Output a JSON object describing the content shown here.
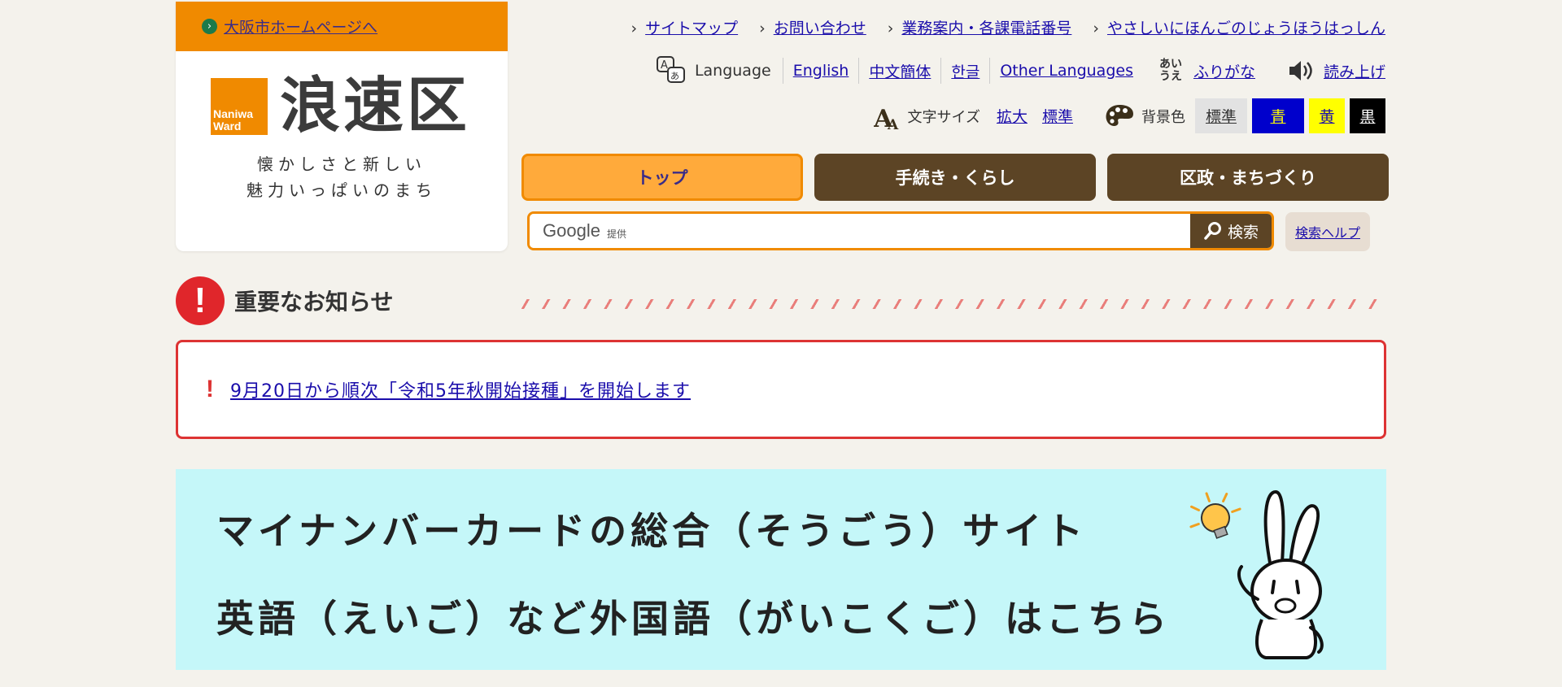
{
  "logo": {
    "city_link": "大阪市ホームページへ",
    "mark_text_line1": "Naniwa",
    "mark_text_line2": "Ward",
    "name": "浪速区",
    "tagline_line1": "懐かしさと新しい",
    "tagline_line2": "魅力いっぱいのまち"
  },
  "utility_links": [
    "サイトマップ",
    "お問い合わせ",
    "業務案内・各課電話番号",
    "やさしいにほんごのじょうほうはっしん"
  ],
  "language": {
    "label": "Language",
    "options": [
      "English",
      "中文簡体",
      "한글",
      "Other Languages"
    ],
    "furigana_icon_line1": "あい",
    "furigana_icon_line2": "うえ",
    "furigana": "ふりがな",
    "read_aloud": "読み上げ"
  },
  "display": {
    "text_size_label": "文字サイズ",
    "enlarge": "拡大",
    "standard": "標準",
    "bg_label": "背景色",
    "bg_options": [
      {
        "label": "標準",
        "bg": "#e2e2e2",
        "fg": "#333333"
      },
      {
        "label": "青",
        "bg": "#0000cc",
        "fg": "#ffff00"
      },
      {
        "label": "黄",
        "bg": "#ffff00",
        "fg": "#1a0dab"
      },
      {
        "label": "黒",
        "bg": "#000000",
        "fg": "#ffffff"
      }
    ]
  },
  "nav": {
    "tabs": [
      "トップ",
      "手続き・くらし",
      "区政・まちづくり"
    ],
    "active_index": 0
  },
  "search": {
    "google_label": "Google",
    "provided": "提供",
    "button": "検索",
    "help": "検索ヘルプ"
  },
  "notice": {
    "heading": "重要なお知らせ",
    "items": [
      "9月20日から順次「令和5年秋開始接種」を開始します"
    ]
  },
  "banner": {
    "line1": "マイナンバーカードの総合（そうごう）サイト",
    "line2": "英語（えいご）など外国語（がいこくご）はこちら"
  },
  "colors": {
    "accent_orange": "#f08a00",
    "nav_dark": "#5c4425",
    "alert_red": "#e0262b",
    "banner_bg": "#c5f7f9"
  }
}
